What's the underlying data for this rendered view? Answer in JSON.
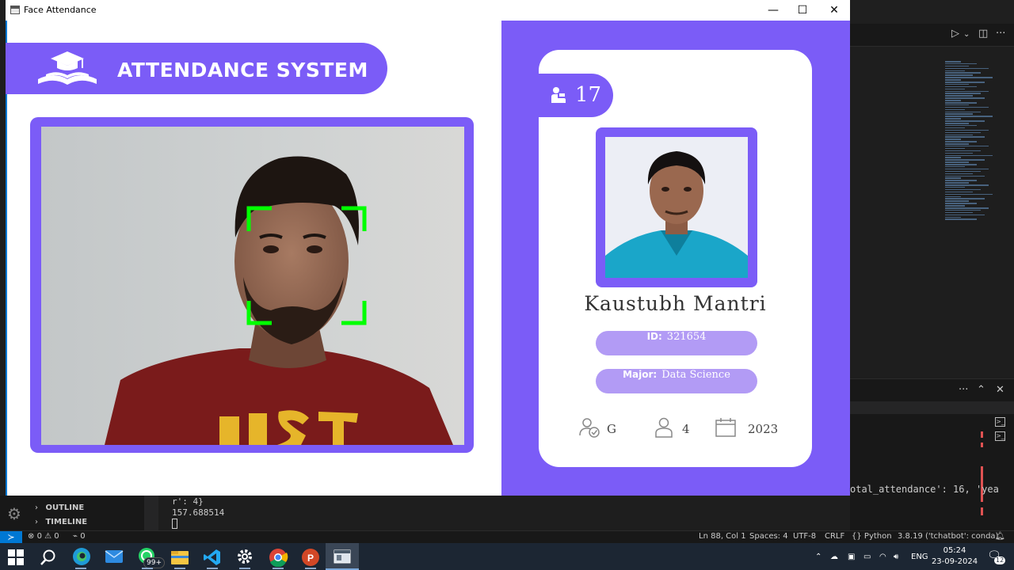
{
  "window": {
    "title": "Face Attendance",
    "minimize": "—",
    "maximize": "☐",
    "close": "✕"
  },
  "app": {
    "header_title": "ATTENDANCE SYSTEM",
    "student": {
      "total_attendance": "17",
      "name": "Kaustubh Mantri",
      "id_label": "ID:",
      "id_value": "321654",
      "major_label": "Major:",
      "major_value": "Data Science",
      "standing": "G",
      "year": "4",
      "starting_year": "2023"
    },
    "colors": {
      "accent": "#7b5cf7",
      "pill": "#b29bf5",
      "face_box": "#00ff00"
    }
  },
  "vscode": {
    "sidebar": {
      "outline": "OUTLINE",
      "timeline": "TIMELINE"
    },
    "terminal": {
      "line1": "r': 4}",
      "line2": "157.688514",
      "right_text": "otal_attendance': 16, 'yea"
    },
    "status": {
      "errors": "0",
      "warnings": "0",
      "ports": "0",
      "position": "Ln 88, Col 1",
      "spaces": "Spaces: 4",
      "encoding": "UTF-8",
      "eol": "CRLF",
      "language": "Python",
      "interpreter": "3.8.19 ('tchatbot': conda)"
    }
  },
  "taskbar": {
    "whatsapp_badge": "99+",
    "language": "ENG",
    "time": "05:24",
    "date": "23-09-2024",
    "notifications": "12"
  }
}
